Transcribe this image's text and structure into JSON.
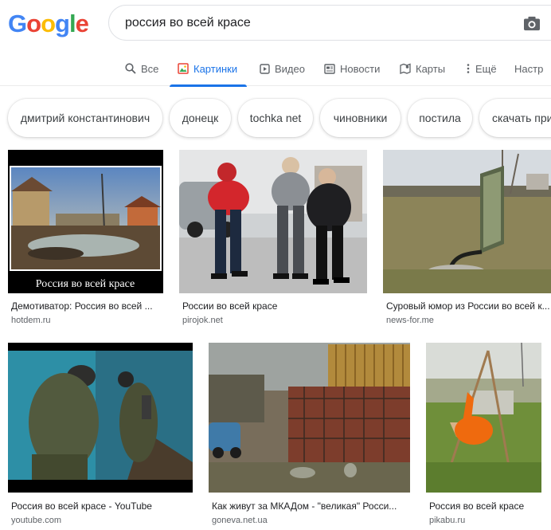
{
  "logo": "Google",
  "search": {
    "query": "россия во всей красе"
  },
  "tabs": [
    {
      "label": "Все",
      "icon": "search-icon"
    },
    {
      "label": "Картинки",
      "icon": "image-icon",
      "active": true
    },
    {
      "label": "Видео",
      "icon": "video-icon"
    },
    {
      "label": "Новости",
      "icon": "news-icon"
    },
    {
      "label": "Карты",
      "icon": "maps-icon"
    },
    {
      "label": "Ещё",
      "icon": "more-vert-icon"
    },
    {
      "label": "Настр",
      "icon": ""
    }
  ],
  "chips": [
    "дмитрий константинович",
    "донецк",
    "tochka net",
    "чиновники",
    "постила",
    "скачать при"
  ],
  "results": [
    {
      "title": "Демотиватор: Россия во всей ...",
      "source": "hotdem.ru",
      "image_caption": "Россия во всей красе"
    },
    {
      "title": "России во всей красе",
      "source": "pirojok.net"
    },
    {
      "title": "Суровый юмор из России во всей к...",
      "source": "news-for.me"
    },
    {
      "title": "Россия во всей красе - YouTube",
      "source": "youtube.com"
    },
    {
      "title": "Как живут за МКАДом - \"великая\" Росси...",
      "source": "goneva.net.ua"
    },
    {
      "title": "Россия во всей красе",
      "source": "pikabu.ru"
    }
  ],
  "colors": {
    "accent": "#1a73e8",
    "muted": "#5f6368"
  }
}
